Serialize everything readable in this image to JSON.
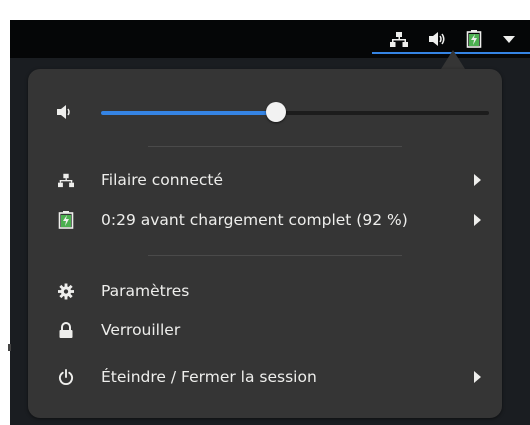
{
  "topbar": {
    "status_icons": [
      "network-wired-icon",
      "audio-volume-icon",
      "battery-charging-icon",
      "dropdown-arrow-icon"
    ],
    "accent_color": "#3584e4"
  },
  "menu": {
    "volume": {
      "level": 0.45,
      "icon": "audio-volume-low-icon"
    },
    "items": [
      {
        "label": "Filaire connecté",
        "icon": "network-wired-icon",
        "has_submenu": true
      },
      {
        "label": "0:29 avant chargement complet (92 %)",
        "icon": "battery-charging-icon",
        "has_submenu": true
      },
      {
        "label": "Paramètres",
        "icon": "settings-icon",
        "has_submenu": false
      },
      {
        "label": "Verrouiller",
        "icon": "lock-icon",
        "has_submenu": false
      },
      {
        "label": "Éteindre / Fermer la session",
        "icon": "power-icon",
        "has_submenu": true
      }
    ]
  }
}
